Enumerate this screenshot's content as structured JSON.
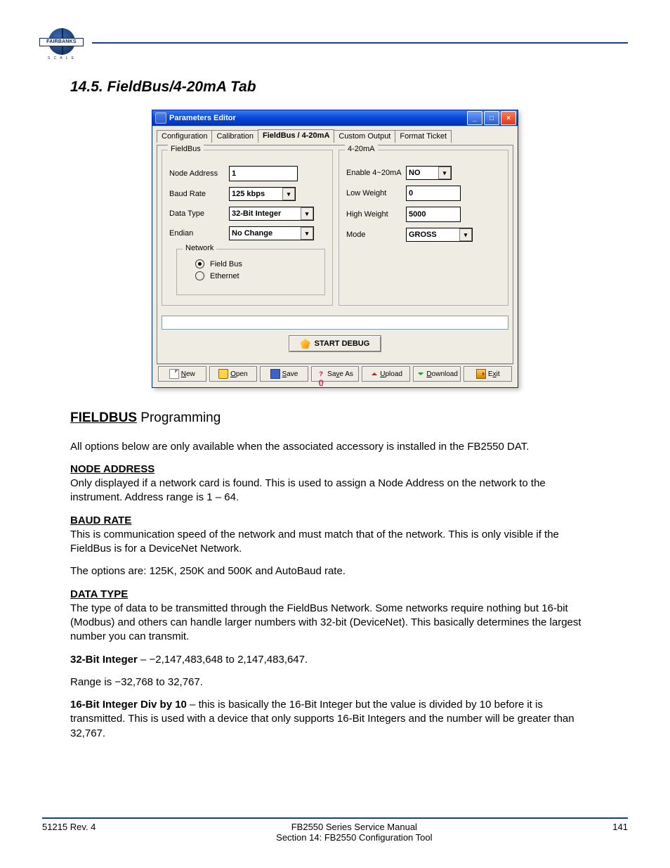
{
  "logo": {
    "brand": "FAIRBANKS",
    "sub": "S C A L E"
  },
  "heading": "14.5.  FieldBus/4-20mA Tab",
  "window": {
    "title": "Parameters Editor",
    "tabs": [
      {
        "label": "Configuration",
        "mn": "C"
      },
      {
        "label": "Calibration",
        "mn": "r"
      },
      {
        "label": "FieldBus / 4-20mA",
        "mn": "4"
      },
      {
        "label": "Custom Output",
        "mn": "C"
      },
      {
        "label": "Format Ticket",
        "mn": "F"
      }
    ],
    "sel_tab": 2,
    "fieldbus": {
      "legend": "FieldBus",
      "node_addr": {
        "label": "Node Address",
        "value": "1"
      },
      "baud": {
        "label": "Baud Rate",
        "value": "125 kbps"
      },
      "data_type": {
        "label": "Data Type",
        "value": "32-Bit Integer"
      },
      "endian": {
        "label": "Endian",
        "value": "No Change"
      },
      "net": {
        "legend": "Network",
        "opt1": "Field Bus",
        "opt2": "Ethernet",
        "selected": 0
      }
    },
    "m420": {
      "legend": "4-20mA",
      "enable": {
        "label": "Enable 4~20mA",
        "value": "NO"
      },
      "low": {
        "label": "Low Weight",
        "value": "0"
      },
      "high": {
        "label": "High Weight",
        "value": "5000"
      },
      "mode": {
        "label": "Mode",
        "value": "GROSS"
      }
    },
    "debug_label": "START DEBUG",
    "buttons": {
      "new": "New",
      "open": "Open",
      "save": "Save",
      "saveas": "Save As",
      "upload": "Upload",
      "download": "Download",
      "exit": "Exit"
    }
  },
  "doc": {
    "subhead_u": "FIELDBUS",
    "subhead_rest": " Programming",
    "intro": "All options below are only available when the associated accessory is installed in the FB2550 DAT.",
    "node_head": "NODE ADDRESS",
    "node_text": "Only displayed if a network card is found. This is used to assign a Node Address on the network to the instrument. Address range is 1 – 64.",
    "baud_head": "BAUD RATE",
    "baud_text1": "This is communication speed of the network and must match that of the network. This is only visible if the FieldBus is for a DeviceNet Network.",
    "baud_text2": "The options are: 125K, 250K and 500K and AutoBaud rate.",
    "data_head": "DATA TYPE",
    "data_text1": "The type of data to be transmitted through the FieldBus Network. Some networks require nothing but 16-bit (Modbus) and others can handle larger numbers with 32-bit (DeviceNet). This basically determines the largest number you can transmit.",
    "data_32_lead": "32-Bit Integer",
    "data_32_rest": " – −2,147,483,648 to 2,147,483,647.",
    "data_range_line": "Range is −32,768 to 32,767.",
    "data_div_lead": "16-Bit Integer Div by 10",
    "data_div_rest": " – this is basically the 16-Bit Integer but the value is divided by 10 before it is transmitted. This is used with a device that only supports 16-Bit Integers and the number will be greater than 32,767."
  },
  "footer": {
    "left": "51215 Rev. 4",
    "center_line1": "FB2550 Series Service Manual",
    "center_line2": "Section 14: FB2550 Configuration Tool",
    "right": "141"
  }
}
